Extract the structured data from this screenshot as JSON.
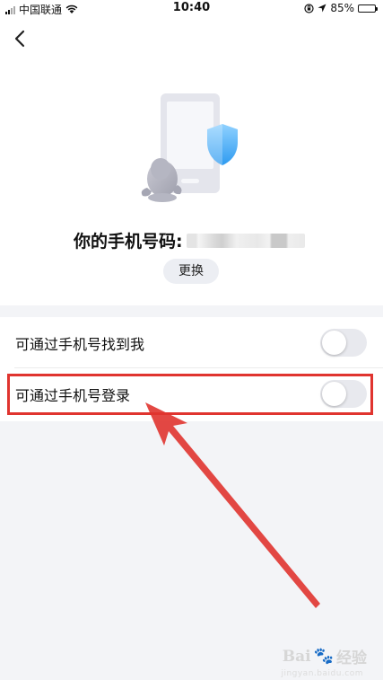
{
  "status_bar": {
    "carrier": "中国联通",
    "time": "10:40",
    "battery_percent": "85%",
    "battery_level": 0.85,
    "battery_color": "#3bb84a"
  },
  "header": {
    "back_icon": "chevron-left-icon"
  },
  "illustration": {
    "icon": "phone-shield-penguin-illustration"
  },
  "phone": {
    "title": "你的手机号码:",
    "change_label": "更换"
  },
  "settings": {
    "items": [
      {
        "label": "可通过手机号找到我",
        "enabled": false
      },
      {
        "label": "可通过手机号登录",
        "enabled": false
      }
    ]
  },
  "annotation": {
    "highlight_color": "#e0342f"
  },
  "watermark": {
    "brand": "Bai",
    "suffix": "经验",
    "url": "jingyan.baidu.com"
  }
}
